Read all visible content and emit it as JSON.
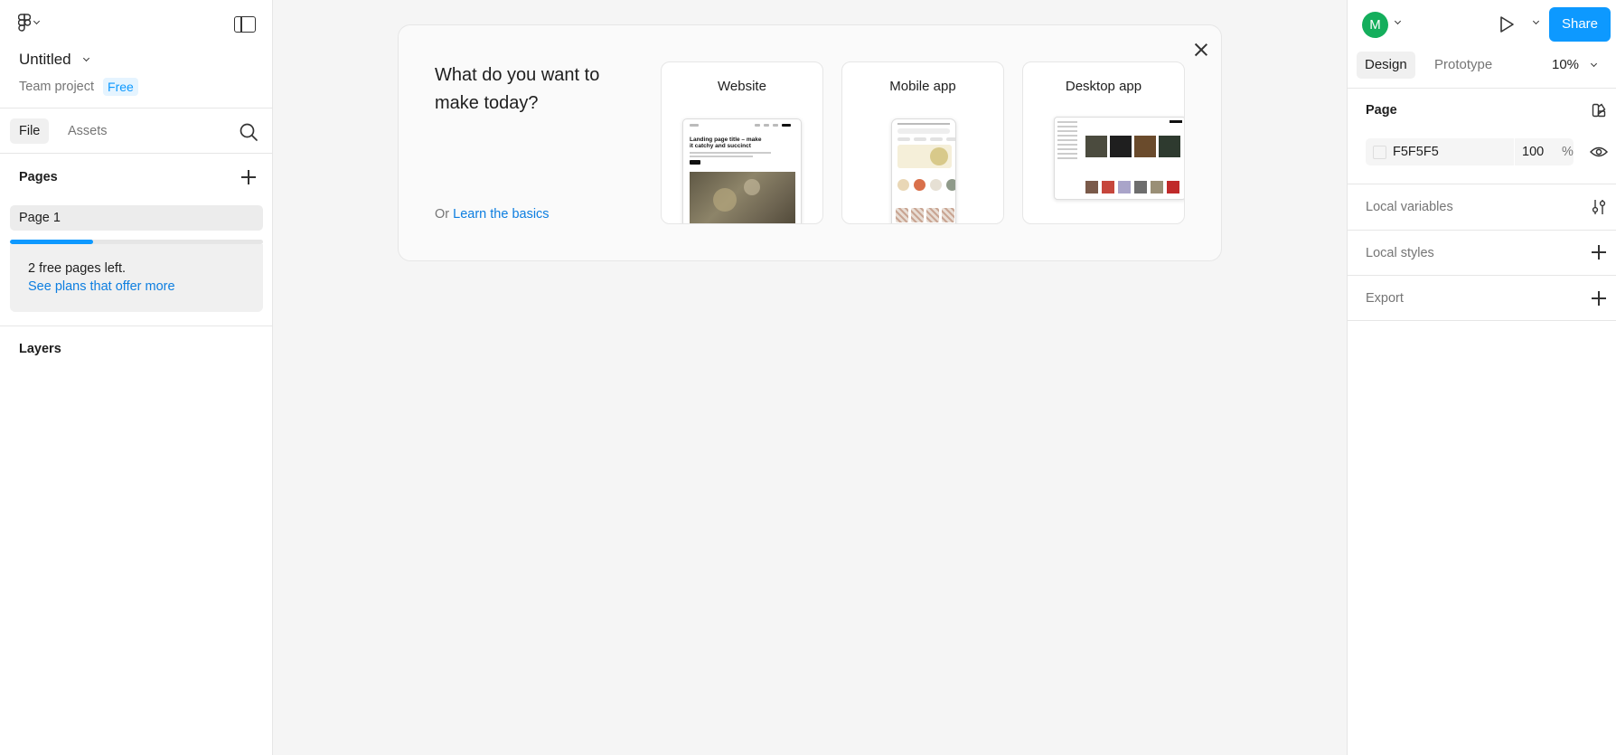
{
  "sidebar": {
    "file_title": "Untitled",
    "team": "Team project",
    "plan_badge": "Free",
    "tabs": [
      {
        "label": "File"
      },
      {
        "label": "Assets"
      }
    ],
    "pages_title": "Pages",
    "pages": [
      {
        "label": "Page 1"
      }
    ],
    "free_pages_progress": 0.33,
    "upsell_text": "2 free pages left.",
    "upsell_link": "See plans that offer more",
    "layers_title": "Layers"
  },
  "dialog": {
    "question": "What do you want to make today?",
    "or_text": "Or",
    "learn_link": "Learn the basics",
    "cards": [
      {
        "label": "Website",
        "thumb_heading": "Landing page title – make it catchy and succinct"
      },
      {
        "label": "Mobile app"
      },
      {
        "label": "Desktop app"
      }
    ]
  },
  "right_panel": {
    "avatar_initial": "M",
    "avatar_color": "#14AE5C",
    "share_label": "Share",
    "accent_color": "#0D99FF",
    "tabs": [
      {
        "label": "Design"
      },
      {
        "label": "Prototype"
      }
    ],
    "zoom": "10%",
    "page_section_title": "Page",
    "page_color_hex": "F5F5F5",
    "page_opacity": "100",
    "opacity_unit": "%",
    "local_variables": "Local variables",
    "local_styles": "Local styles",
    "export": "Export"
  },
  "icons": [
    "figma-logo-icon",
    "sidebar-toggle-icon",
    "search-icon",
    "add-page-icon",
    "close-icon",
    "play-icon",
    "styles-icon",
    "eye-icon",
    "variables-adjust-icon",
    "add-style-icon",
    "add-export-icon"
  ]
}
